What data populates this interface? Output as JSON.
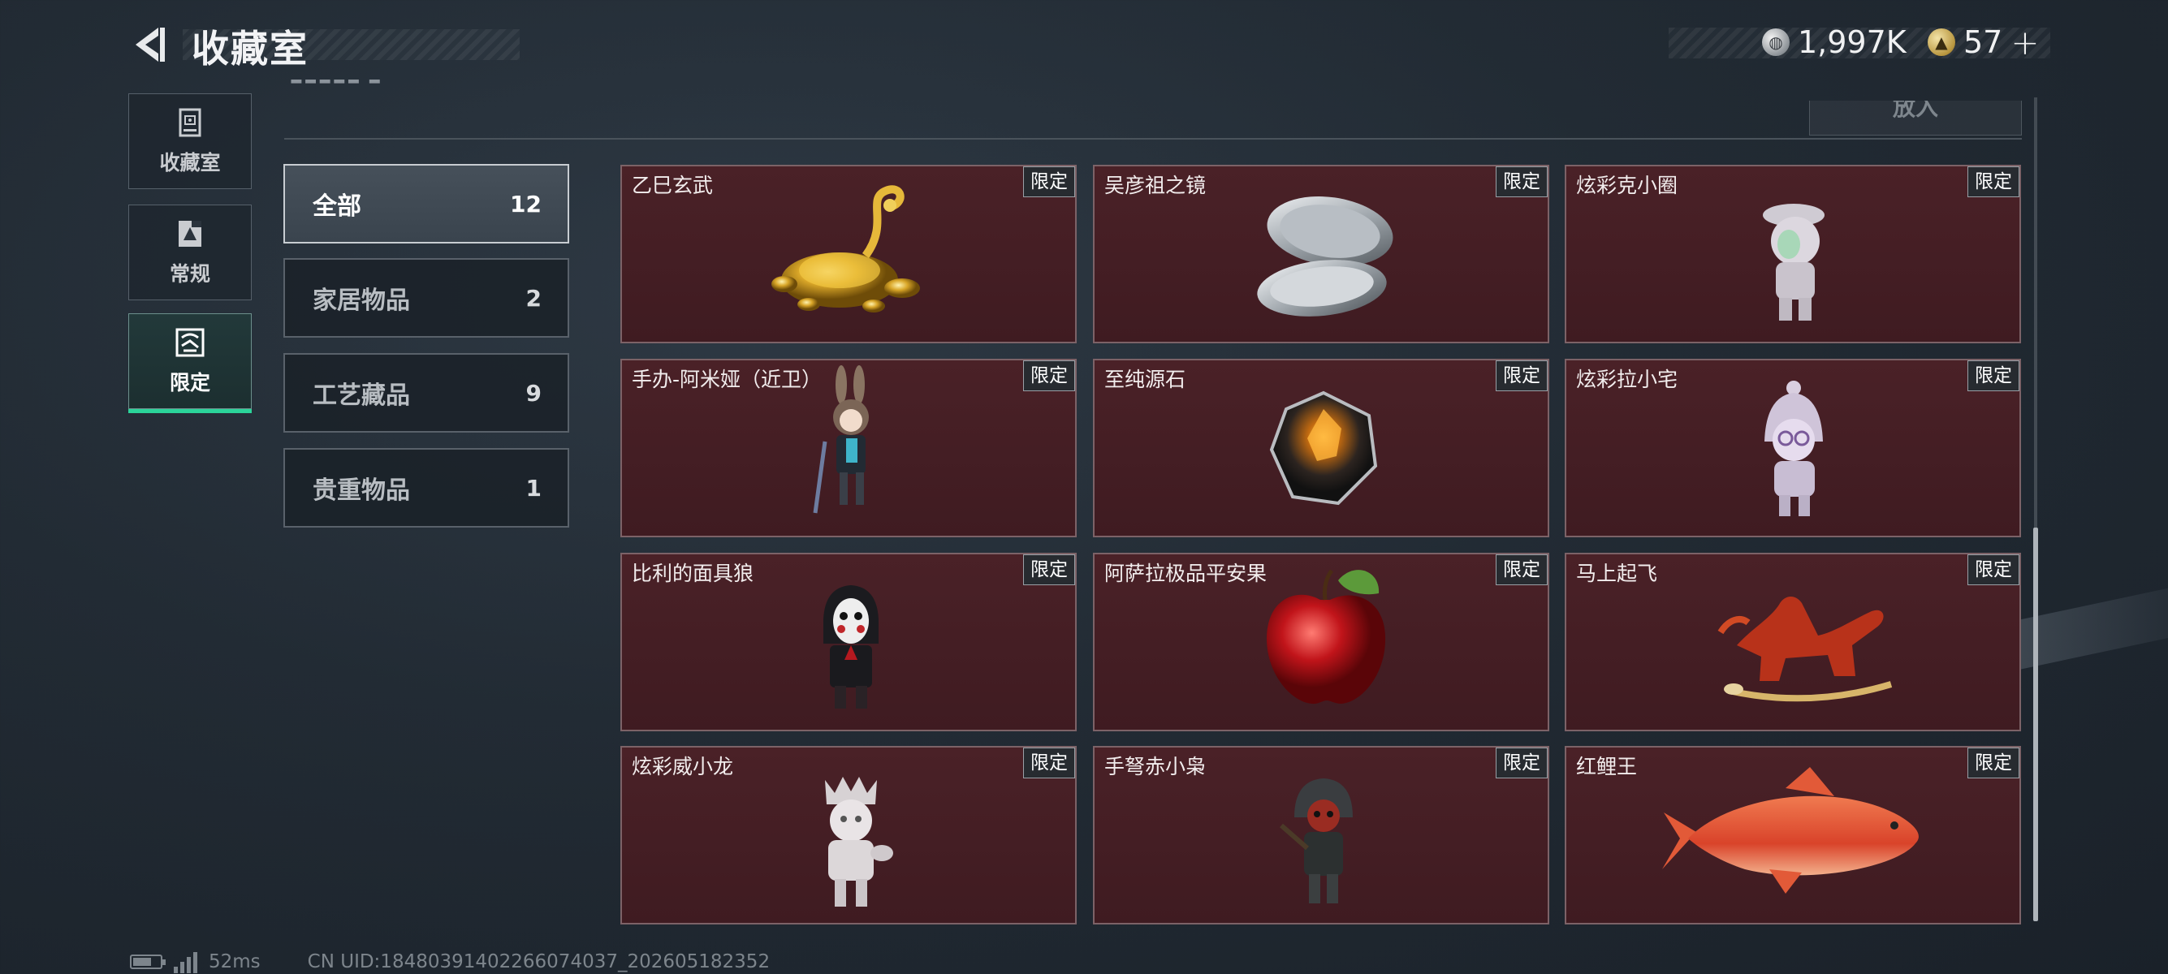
{
  "header": {
    "title": "收藏室",
    "currency": [
      {
        "icon": "silver-coin-icon",
        "value": "1,997K"
      },
      {
        "icon": "gold-coin-icon",
        "value": "57"
      }
    ]
  },
  "sidebar": {
    "tabs": [
      {
        "label": "收藏室",
        "icon": "collection-cabinet-icon",
        "active": false
      },
      {
        "label": "常规",
        "icon": "regular-card-icon",
        "active": false
      },
      {
        "label": "限定",
        "icon": "limited-icon",
        "active": true
      }
    ]
  },
  "top": {
    "put_label": "放入"
  },
  "categories": [
    {
      "name": "全部",
      "count": "12",
      "active": true
    },
    {
      "name": "家居物品",
      "count": "2",
      "active": false
    },
    {
      "name": "工艺藏品",
      "count": "9",
      "active": false
    },
    {
      "name": "贵重物品",
      "count": "1",
      "active": false
    }
  ],
  "items": [
    {
      "name": "乙巳玄武",
      "badge": "限定",
      "art": "golden-tortoise-snake-icon"
    },
    {
      "name": "吴彦祖之镜",
      "badge": "限定",
      "art": "compact-mirror-icon"
    },
    {
      "name": "炫彩克小圈",
      "badge": "限定",
      "art": "silver-figure-icon"
    },
    {
      "name": "手办-阿米娅（近卫）",
      "badge": "限定",
      "art": "amiya-figure-icon"
    },
    {
      "name": "至纯源石",
      "badge": "限定",
      "art": "originium-gem-icon"
    },
    {
      "name": "炫彩拉小宅",
      "badge": "限定",
      "art": "hooded-figure-icon"
    },
    {
      "name": "比利的面具狼",
      "badge": "限定",
      "art": "billy-puppet-icon"
    },
    {
      "name": "阿萨拉极品平安果",
      "badge": "限定",
      "art": "red-apple-icon"
    },
    {
      "name": "马上起飞",
      "badge": "限定",
      "art": "rocking-horse-icon"
    },
    {
      "name": "炫彩威小龙",
      "badge": "限定",
      "art": "white-figure-icon"
    },
    {
      "name": "手弩赤小枭",
      "badge": "限定",
      "art": "crossbow-figure-icon"
    },
    {
      "name": "红鲤王",
      "badge": "限定",
      "art": "red-carp-icon"
    }
  ],
  "status": {
    "ping": "52ms",
    "uid": "CN UID:18480391402266074037_202605182352"
  }
}
